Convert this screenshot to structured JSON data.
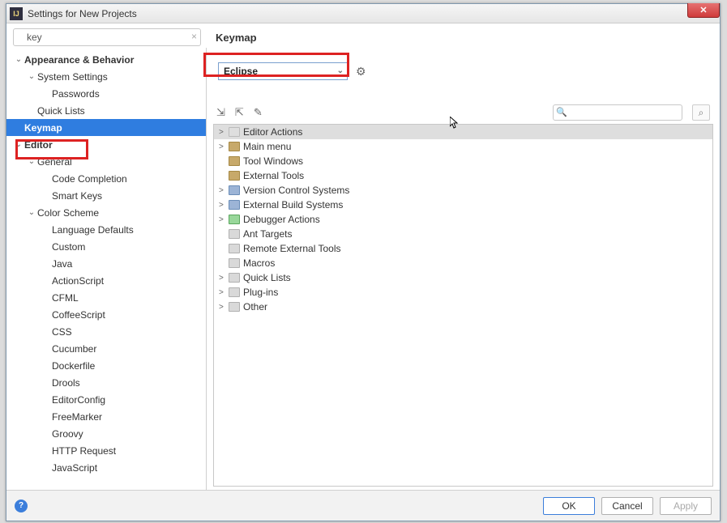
{
  "window": {
    "title": "Settings for New Projects"
  },
  "search": {
    "value": "key"
  },
  "panel": {
    "title": "Keymap"
  },
  "sidebar": [
    {
      "label": "Appearance & Behavior",
      "indent": 0,
      "bold": true,
      "expandable": true
    },
    {
      "label": "System Settings",
      "indent": 1,
      "expandable": true
    },
    {
      "label": "Passwords",
      "indent": 2,
      "leaf": true
    },
    {
      "label": "Quick Lists",
      "indent": 1,
      "leaf": true
    },
    {
      "label": "Keymap",
      "indent": 0,
      "bold": true,
      "leaf": true,
      "selected": true
    },
    {
      "label": "Editor",
      "indent": 0,
      "bold": true,
      "expandable": true
    },
    {
      "label": "General",
      "indent": 1,
      "expandable": true
    },
    {
      "label": "Code Completion",
      "indent": 2,
      "leaf": true
    },
    {
      "label": "Smart Keys",
      "indent": 2,
      "leaf": true
    },
    {
      "label": "Color Scheme",
      "indent": 1,
      "expandable": true
    },
    {
      "label": "Language Defaults",
      "indent": 2,
      "leaf": true
    },
    {
      "label": "Custom",
      "indent": 2,
      "leaf": true
    },
    {
      "label": "Java",
      "indent": 2,
      "leaf": true
    },
    {
      "label": "ActionScript",
      "indent": 2,
      "leaf": true
    },
    {
      "label": "CFML",
      "indent": 2,
      "leaf": true
    },
    {
      "label": "CoffeeScript",
      "indent": 2,
      "leaf": true
    },
    {
      "label": "CSS",
      "indent": 2,
      "leaf": true
    },
    {
      "label": "Cucumber",
      "indent": 2,
      "leaf": true
    },
    {
      "label": "Dockerfile",
      "indent": 2,
      "leaf": true
    },
    {
      "label": "Drools",
      "indent": 2,
      "leaf": true
    },
    {
      "label": "EditorConfig",
      "indent": 2,
      "leaf": true
    },
    {
      "label": "FreeMarker",
      "indent": 2,
      "leaf": true
    },
    {
      "label": "Groovy",
      "indent": 2,
      "leaf": true
    },
    {
      "label": "HTTP Request",
      "indent": 2,
      "leaf": true
    },
    {
      "label": "JavaScript",
      "indent": 2,
      "leaf": true
    }
  ],
  "keymap": {
    "selected": "Eclipse"
  },
  "filter": {
    "placeholder": ""
  },
  "actions": [
    {
      "label": "Editor Actions",
      "chev": ">",
      "cls": "none",
      "sel": true
    },
    {
      "label": "Main menu",
      "chev": ">",
      "cls": ""
    },
    {
      "label": "Tool Windows",
      "chev": "",
      "cls": ""
    },
    {
      "label": "External Tools",
      "chev": "",
      "cls": ""
    },
    {
      "label": "Version Control Systems",
      "chev": ">",
      "cls": "blue"
    },
    {
      "label": "External Build Systems",
      "chev": ">",
      "cls": "blue"
    },
    {
      "label": "Debugger Actions",
      "chev": ">",
      "cls": "bug"
    },
    {
      "label": "Ant Targets",
      "chev": "",
      "cls": "light"
    },
    {
      "label": "Remote External Tools",
      "chev": "",
      "cls": "light"
    },
    {
      "label": "Macros",
      "chev": "",
      "cls": "light"
    },
    {
      "label": "Quick Lists",
      "chev": ">",
      "cls": "light"
    },
    {
      "label": "Plug-ins",
      "chev": ">",
      "cls": "light"
    },
    {
      "label": "Other",
      "chev": ">",
      "cls": "light"
    }
  ],
  "buttons": {
    "ok": "OK",
    "cancel": "Cancel",
    "apply": "Apply"
  }
}
